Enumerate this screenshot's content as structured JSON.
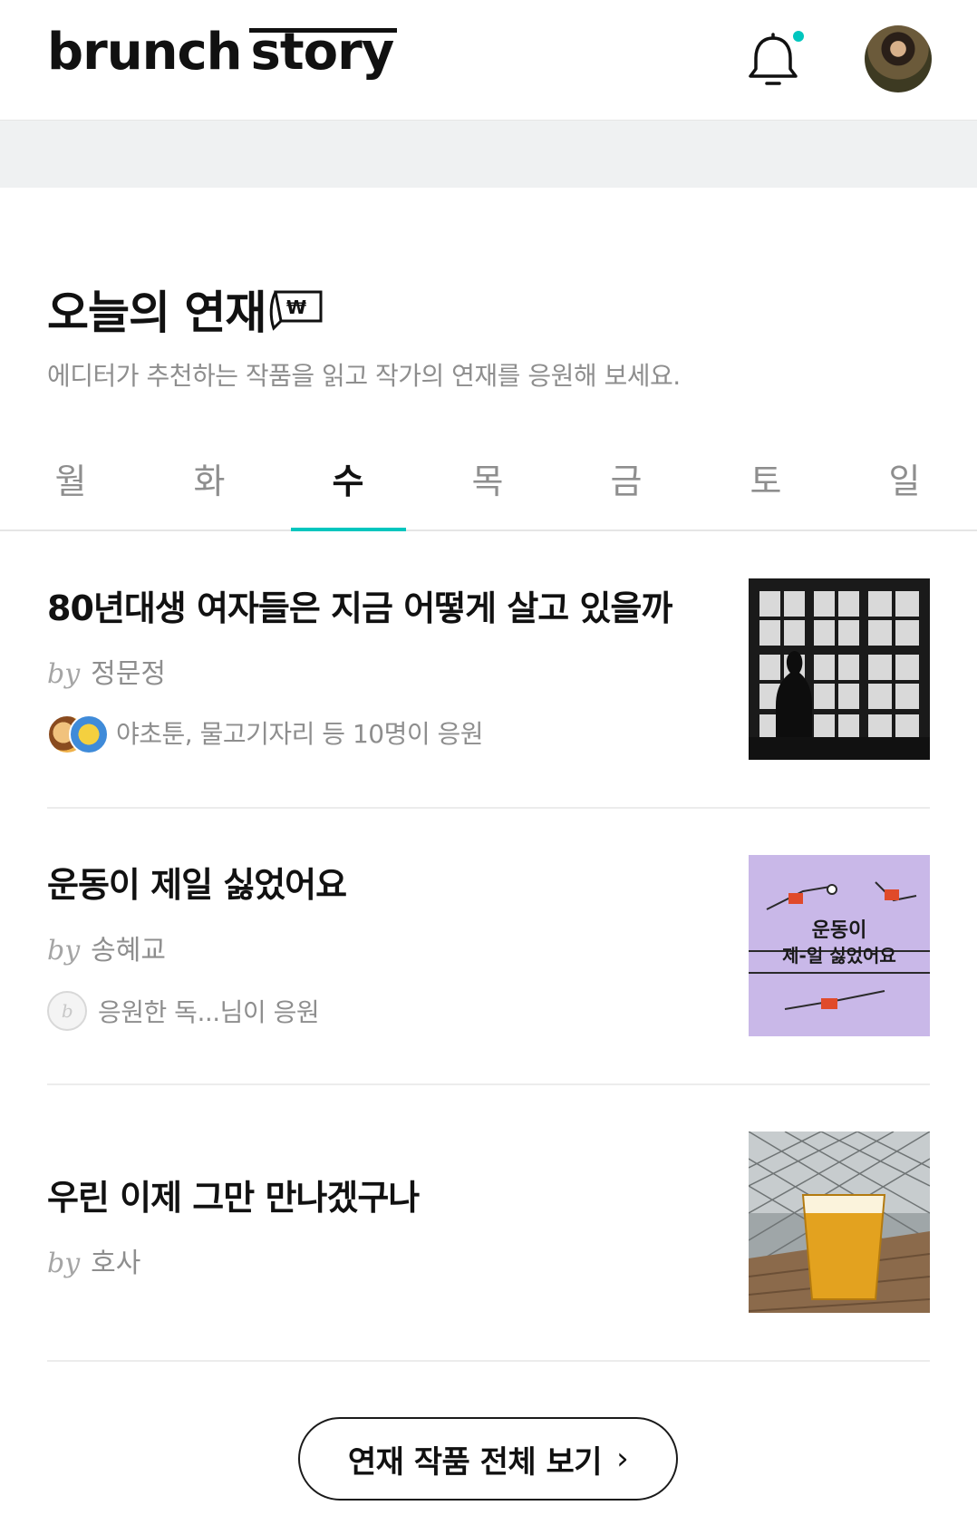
{
  "header": {
    "logo_part1": "brunch",
    "logo_part2": "story",
    "notification_dot_color": "#00c6be"
  },
  "section": {
    "title": "오늘의 연재",
    "subtitle": "에디터가 추천하는 작품을 읽고 작가의 연재를 응원해 보세요."
  },
  "tabs": [
    {
      "label": "월",
      "active": false
    },
    {
      "label": "화",
      "active": false
    },
    {
      "label": "수",
      "active": true
    },
    {
      "label": "목",
      "active": false
    },
    {
      "label": "금",
      "active": false
    },
    {
      "label": "토",
      "active": false
    },
    {
      "label": "일",
      "active": false
    }
  ],
  "accent_color": "#00c6be",
  "items": [
    {
      "title": "80년대생 여자들은 지금 어떻게 살고 있을까",
      "by": "by",
      "author": "정문정",
      "cheer": "야초툰, 물고기자리 등 10명이 응원"
    },
    {
      "title": "운동이 제일 싫었어요",
      "by": "by",
      "author": "송혜교",
      "cheer": "응원한 독...님이 응원",
      "thumb_text_1": "운동이",
      "thumb_text_2": "제-일 싫었어요"
    },
    {
      "title": "우린 이제 그만 만나겠구나",
      "by": "by",
      "author": "호사",
      "cheer": ""
    }
  ],
  "all_button": {
    "label": "연재 작품 전체 보기",
    "chevron": "›"
  }
}
